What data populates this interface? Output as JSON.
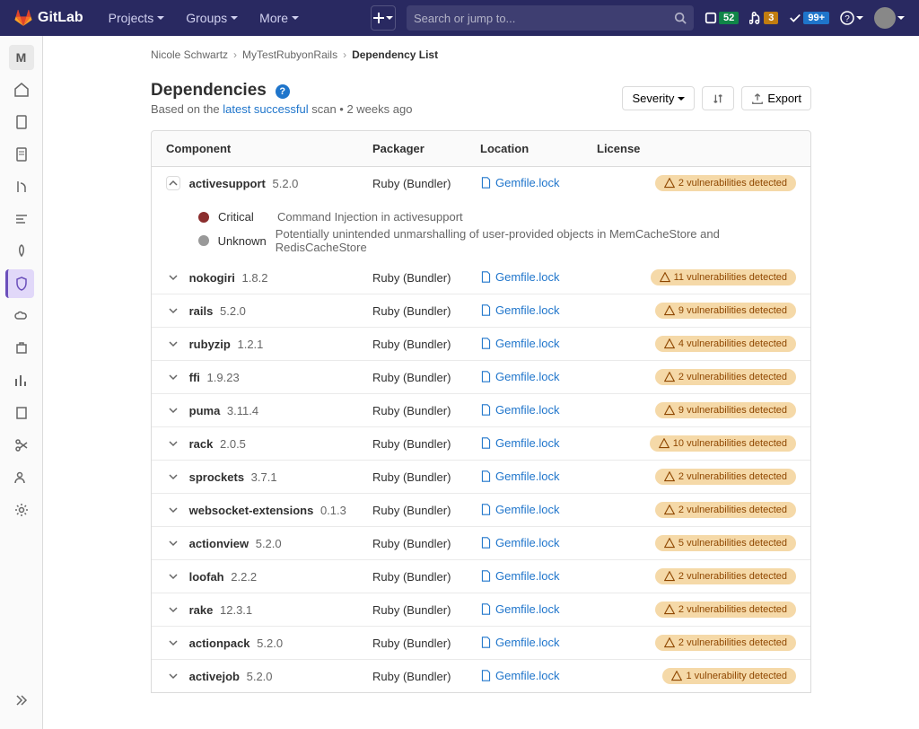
{
  "navbar": {
    "brand": "GitLab",
    "projects": "Projects",
    "groups": "Groups",
    "more": "More",
    "search_placeholder": "Search or jump to...",
    "counter_issues": "52",
    "counter_mr": "3",
    "counter_todo": "99+"
  },
  "sidenav": {
    "project_letter": "M"
  },
  "breadcrumb": {
    "owner": "Nicole Schwartz",
    "project": "MyTestRubyonRails",
    "page": "Dependency List"
  },
  "page": {
    "title": "Dependencies",
    "sub_prefix": "Based on the ",
    "sub_link": "latest successful",
    "sub_suffix": " scan • 2 weeks ago",
    "btn_severity": "Severity",
    "btn_export": "Export"
  },
  "columns": {
    "component": "Component",
    "packager": "Packager",
    "location": "Location",
    "license": "License"
  },
  "expanded": {
    "name": "activesupport",
    "version": "5.2.0",
    "packager": "Ruby (Bundler)",
    "location": "Gemfile.lock",
    "badge": "2 vulnerabilities detected",
    "sev1_label": "Critical",
    "sev1_text": "Command Injection in activesupport",
    "sev2_label": "Unknown",
    "sev2_text": "Potentially unintended unmarshalling of user-provided objects in MemCacheStore and RedisCacheStore"
  },
  "rows": [
    {
      "name": "nokogiri",
      "version": "1.8.2",
      "packager": "Ruby (Bundler)",
      "location": "Gemfile.lock",
      "badge": "11 vulnerabilities detected"
    },
    {
      "name": "rails",
      "version": "5.2.0",
      "packager": "Ruby (Bundler)",
      "location": "Gemfile.lock",
      "badge": "9 vulnerabilities detected"
    },
    {
      "name": "rubyzip",
      "version": "1.2.1",
      "packager": "Ruby (Bundler)",
      "location": "Gemfile.lock",
      "badge": "4 vulnerabilities detected"
    },
    {
      "name": "ffi",
      "version": "1.9.23",
      "packager": "Ruby (Bundler)",
      "location": "Gemfile.lock",
      "badge": "2 vulnerabilities detected"
    },
    {
      "name": "puma",
      "version": "3.11.4",
      "packager": "Ruby (Bundler)",
      "location": "Gemfile.lock",
      "badge": "9 vulnerabilities detected"
    },
    {
      "name": "rack",
      "version": "2.0.5",
      "packager": "Ruby (Bundler)",
      "location": "Gemfile.lock",
      "badge": "10 vulnerabilities detected"
    },
    {
      "name": "sprockets",
      "version": "3.7.1",
      "packager": "Ruby (Bundler)",
      "location": "Gemfile.lock",
      "badge": "2 vulnerabilities detected"
    },
    {
      "name": "websocket-extensions",
      "version": "0.1.3",
      "packager": "Ruby (Bundler)",
      "location": "Gemfile.lock",
      "badge": "2 vulnerabilities detected"
    },
    {
      "name": "actionview",
      "version": "5.2.0",
      "packager": "Ruby (Bundler)",
      "location": "Gemfile.lock",
      "badge": "5 vulnerabilities detected"
    },
    {
      "name": "loofah",
      "version": "2.2.2",
      "packager": "Ruby (Bundler)",
      "location": "Gemfile.lock",
      "badge": "2 vulnerabilities detected"
    },
    {
      "name": "rake",
      "version": "12.3.1",
      "packager": "Ruby (Bundler)",
      "location": "Gemfile.lock",
      "badge": "2 vulnerabilities detected"
    },
    {
      "name": "actionpack",
      "version": "5.2.0",
      "packager": "Ruby (Bundler)",
      "location": "Gemfile.lock",
      "badge": "2 vulnerabilities detected"
    },
    {
      "name": "activejob",
      "version": "5.2.0",
      "packager": "Ruby (Bundler)",
      "location": "Gemfile.lock",
      "badge": "1 vulnerability detected"
    }
  ]
}
